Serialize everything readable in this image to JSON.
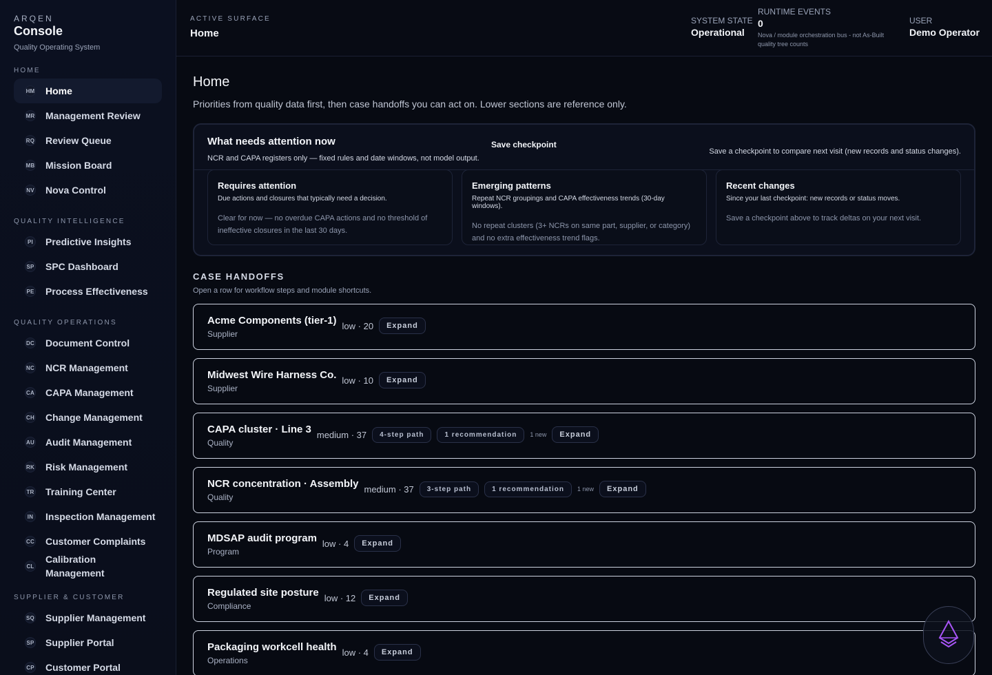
{
  "brand": {
    "top": "ARQEN",
    "name": "Console",
    "subtitle": "Quality Operating System"
  },
  "sidebar": {
    "sections": [
      {
        "title": "HOME",
        "items": [
          {
            "abbr": "HM",
            "label": "Home",
            "active": true
          },
          {
            "abbr": "MR",
            "label": "Management Review"
          },
          {
            "abbr": "RQ",
            "label": "Review Queue"
          },
          {
            "abbr": "MB",
            "label": "Mission Board"
          },
          {
            "abbr": "NV",
            "label": "Nova Control"
          }
        ]
      },
      {
        "title": "QUALITY INTELLIGENCE",
        "items": [
          {
            "abbr": "PI",
            "label": "Predictive Insights"
          },
          {
            "abbr": "SP",
            "label": "SPC Dashboard"
          },
          {
            "abbr": "PE",
            "label": "Process Effectiveness"
          }
        ]
      },
      {
        "title": "QUALITY OPERATIONS",
        "items": [
          {
            "abbr": "DC",
            "label": "Document Control"
          },
          {
            "abbr": "NC",
            "label": "NCR Management"
          },
          {
            "abbr": "CA",
            "label": "CAPA Management"
          },
          {
            "abbr": "CH",
            "label": "Change Management"
          },
          {
            "abbr": "AU",
            "label": "Audit Management"
          },
          {
            "abbr": "RK",
            "label": "Risk Management"
          },
          {
            "abbr": "TR",
            "label": "Training Center"
          },
          {
            "abbr": "IN",
            "label": "Inspection Management"
          },
          {
            "abbr": "CC",
            "label": "Customer Complaints"
          },
          {
            "abbr": "CL",
            "label": "Calibration Management"
          }
        ]
      },
      {
        "title": "SUPPLIER & CUSTOMER",
        "items": [
          {
            "abbr": "SQ",
            "label": "Supplier Management"
          },
          {
            "abbr": "SP",
            "label": "Supplier Portal"
          },
          {
            "abbr": "CP",
            "label": "Customer Portal"
          }
        ]
      }
    ]
  },
  "topbar": {
    "surface_label": "ACTIVE SURFACE",
    "surface_value": "Home",
    "system_state_label": "SYSTEM STATE",
    "system_state_value": "Operational",
    "runtime_label": "RUNTIME EVENTS",
    "runtime_value": "0",
    "runtime_note": "Nova / module orchestration bus - not As-Built quality tree counts",
    "user_label": "USER",
    "user_value": "Demo Operator"
  },
  "page": {
    "title": "Home",
    "description": "Priorities from quality data first, then case handoffs you can act on. Lower sections are reference only."
  },
  "attention": {
    "title": "What needs attention now",
    "subtitle": "NCR and CAPA registers only — fixed rules and date windows, not model output.",
    "save_label": "Save checkpoint",
    "save_note": "Save a checkpoint to compare next visit (new records and status changes).",
    "cards": [
      {
        "title": "Requires attention",
        "subtitle": "Due actions and closures that typically need a decision.",
        "body": "Clear for now — no overdue CAPA actions and no threshold of ineffective closures in the last 30 days."
      },
      {
        "title": "Emerging patterns",
        "subtitle": "Repeat NCR groupings and CAPA effectiveness trends (30-day windows).",
        "body": "No repeat clusters (3+ NCRs on same part, supplier, or category) and no extra effectiveness trend flags."
      },
      {
        "title": "Recent changes",
        "subtitle": "Since your last checkpoint: new records or status moves.",
        "body": "Save a checkpoint above to track deltas on your next visit."
      }
    ]
  },
  "handoffs": {
    "title": "CASE HANDOFFS",
    "subtitle": "Open a row for workflow steps and module shortcuts.",
    "expand_label": "Expand",
    "cases": [
      {
        "name": "Acme Components (tier-1)",
        "type": "Supplier",
        "score": "low · 20",
        "pills": [],
        "new": ""
      },
      {
        "name": "Midwest Wire Harness Co.",
        "type": "Supplier",
        "score": "low · 10",
        "pills": [],
        "new": ""
      },
      {
        "name": "CAPA cluster · Line 3",
        "type": "Quality",
        "score": "medium · 37",
        "pills": [
          "4-step path",
          "1 recommendation"
        ],
        "new": "1 new"
      },
      {
        "name": "NCR concentration · Assembly",
        "type": "Quality",
        "score": "medium · 37",
        "pills": [
          "3-step path",
          "1 recommendation"
        ],
        "new": "1 new"
      },
      {
        "name": "MDSAP audit program",
        "type": "Program",
        "score": "low · 4",
        "pills": [],
        "new": ""
      },
      {
        "name": "Regulated site posture",
        "type": "Compliance",
        "score": "low · 12",
        "pills": [],
        "new": ""
      },
      {
        "name": "Packaging workcell health",
        "type": "Operations",
        "score": "low · 4",
        "pills": [],
        "new": ""
      }
    ]
  },
  "icons": {
    "nova": "nova-crystal-icon"
  },
  "colors": {
    "background": "#070a12",
    "accent": "#a855f7"
  }
}
